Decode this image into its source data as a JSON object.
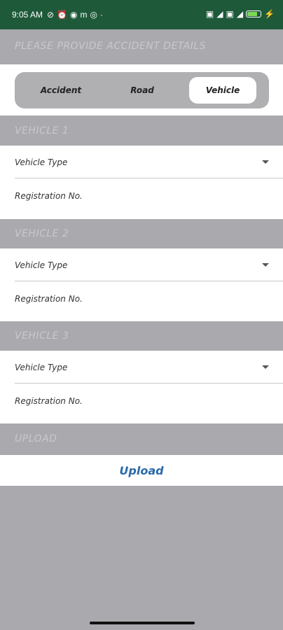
{
  "status_bar": {
    "time": "9:05 AM",
    "left_icons": [
      "mute-icon",
      "alarm-icon",
      "app-icon",
      "m-icon",
      "instagram-icon",
      "dot-icon"
    ],
    "right_icons": [
      "vo-lte-icon",
      "signal-icon",
      "vo-lte-icon",
      "signal-icon",
      "battery-icon",
      "charging-icon"
    ]
  },
  "header": {
    "title": "PLEASE PROVIDE ACCIDENT DETAILS"
  },
  "tabs": [
    {
      "label": "Accident",
      "active": false
    },
    {
      "label": "Road",
      "active": false
    },
    {
      "label": "Vehicle",
      "active": true
    }
  ],
  "vehicles": [
    {
      "section_title": "VEHICLE 1",
      "type_label": "Vehicle Type",
      "registration_label": "Registration No."
    },
    {
      "section_title": "VEHICLE 2",
      "type_label": "Vehicle Type",
      "registration_label": "Registration No."
    },
    {
      "section_title": "VEHICLE 3",
      "type_label": "Vehicle Type",
      "registration_label": "Registration No."
    }
  ],
  "upload": {
    "section_title": "UPLOAD",
    "button_label": "Upload"
  },
  "colors": {
    "status_bar": "#1e5a3a",
    "background": "#aaa9ad",
    "section_text": "#c9c9cc",
    "link": "#2a6aa8",
    "battery": "#7ed957"
  }
}
